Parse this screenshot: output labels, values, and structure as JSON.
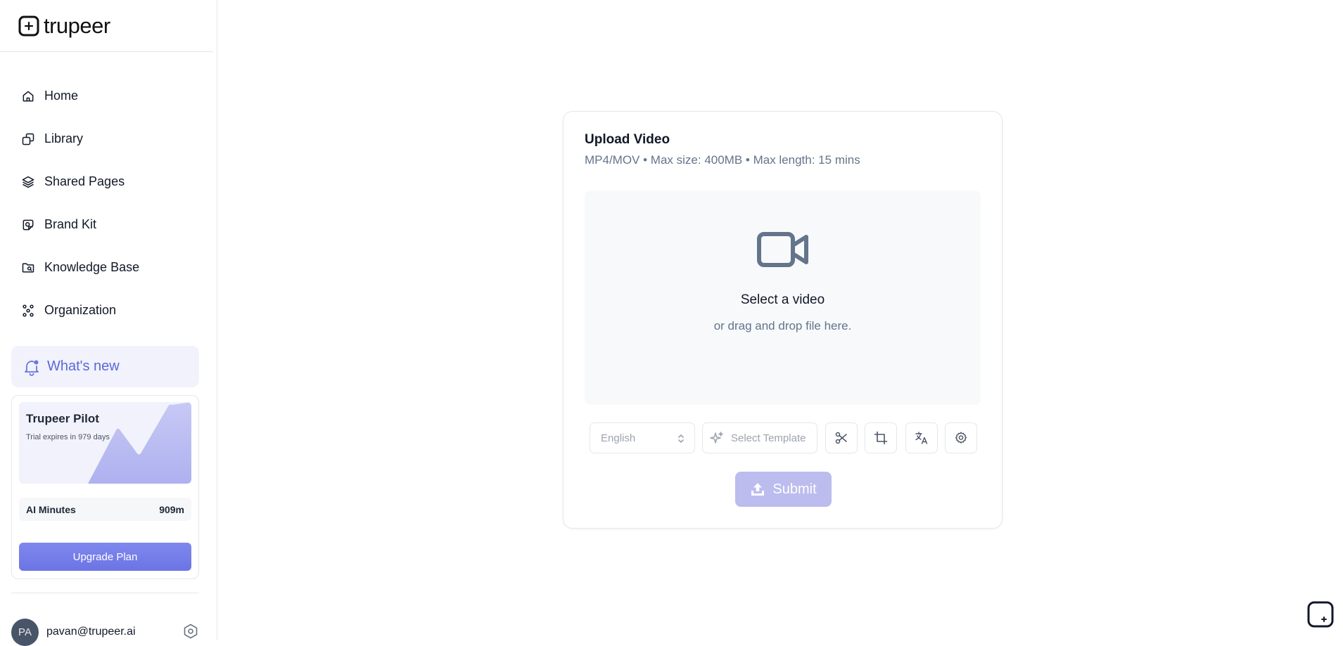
{
  "app": {
    "logo_text": "trupeer",
    "logo_icon": "trupeer-logo-icon"
  },
  "sidebar": {
    "items": [
      {
        "label": "Home",
        "icon": "home-icon"
      },
      {
        "label": "Library",
        "icon": "library-icon"
      },
      {
        "label": "Shared Pages",
        "icon": "layers-icon"
      },
      {
        "label": "Brand Kit",
        "icon": "brand-kit-icon"
      },
      {
        "label": "Knowledge Base",
        "icon": "folder-icon"
      },
      {
        "label": "Organization",
        "icon": "organization-icon"
      }
    ],
    "whats_new": {
      "label": "What's new",
      "icon": "bell-icon",
      "color": "#5a68d8"
    },
    "pilot_card": {
      "title": "Trupeer Pilot",
      "subtitle": "Trial expires in 979 days",
      "minutes_label": "AI Minutes",
      "minutes_value": "909m",
      "upgrade_label": "Upgrade Plan",
      "accent": "#6c74e4"
    },
    "user": {
      "initials": "PA",
      "email": "pavan@trupeer.ai",
      "settings_icon": "settings-hexagon-icon"
    }
  },
  "upload": {
    "title": "Upload Video",
    "subtitle": "MP4/MOV • Max size: 400MB • Max length: 15 mins",
    "dropzone": {
      "icon": "video-camera-icon",
      "title": "Select a video",
      "subtitle": "or drag and drop file here."
    },
    "language": {
      "value": "English",
      "icon": "chevron-up-down-icon"
    },
    "template": {
      "label": "Select Template",
      "icon": "sparkle-icon"
    },
    "tools": [
      "scissors-icon",
      "crop-icon",
      "translate-icon",
      "gear-icon"
    ],
    "submit": {
      "label": "Submit",
      "icon": "upload-icon",
      "color": "#bcbcef"
    }
  },
  "floating_button": {
    "icon": "trupeer-chat-icon"
  }
}
